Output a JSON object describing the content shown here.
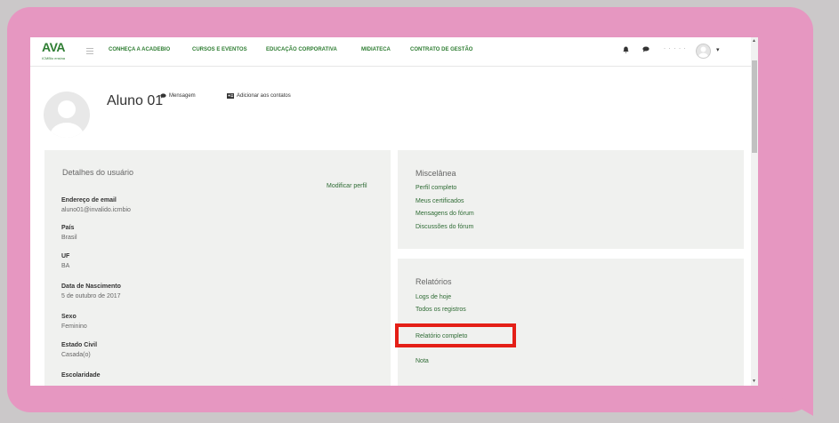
{
  "nav": {
    "logo_text": "AVA",
    "logo_sub": "ICMBio ensina",
    "items": [
      "CONHEÇA A ACADEBIO",
      "CURSOS E EVENTOS",
      "EDUCAÇÃO CORPORATIVA",
      "MIDIATECA",
      "CONTRATO DE GESTÃO"
    ],
    "user_name": "· · · · ·"
  },
  "profile": {
    "name": "Aluno 01",
    "message_label": "Mensagem",
    "add_contact_label": "Adicionar aos contatos"
  },
  "user_details": {
    "title": "Detalhes do usuário",
    "edit_link": "Modificar perfil",
    "fields": [
      {
        "label": "Endereço de email",
        "value": "aluno01@invalido.icmbio"
      },
      {
        "label": "País",
        "value": "Brasil"
      },
      {
        "label": "UF",
        "value": "BA"
      },
      {
        "label": "Data de Nascimento",
        "value": "5 de outubro de 2017"
      },
      {
        "label": "Sexo",
        "value": "Feminino"
      },
      {
        "label": "Estado Civil",
        "value": "Casada(o)"
      },
      {
        "label": "Escolaridade",
        "value": ""
      }
    ]
  },
  "misc": {
    "title": "Miscelânea",
    "links": [
      "Perfil completo",
      "Meus certificados",
      "Mensagens do fórum",
      "Discussões do fórum"
    ]
  },
  "reports": {
    "title": "Relatórios",
    "links": [
      "Logs de hoje",
      "Todos os registros",
      "",
      "Relatório completo",
      "",
      "Nota"
    ]
  },
  "colors": {
    "accent_green": "#2e7d32",
    "highlight_red": "#e41f17",
    "bubble_pink": "#e697c1"
  }
}
